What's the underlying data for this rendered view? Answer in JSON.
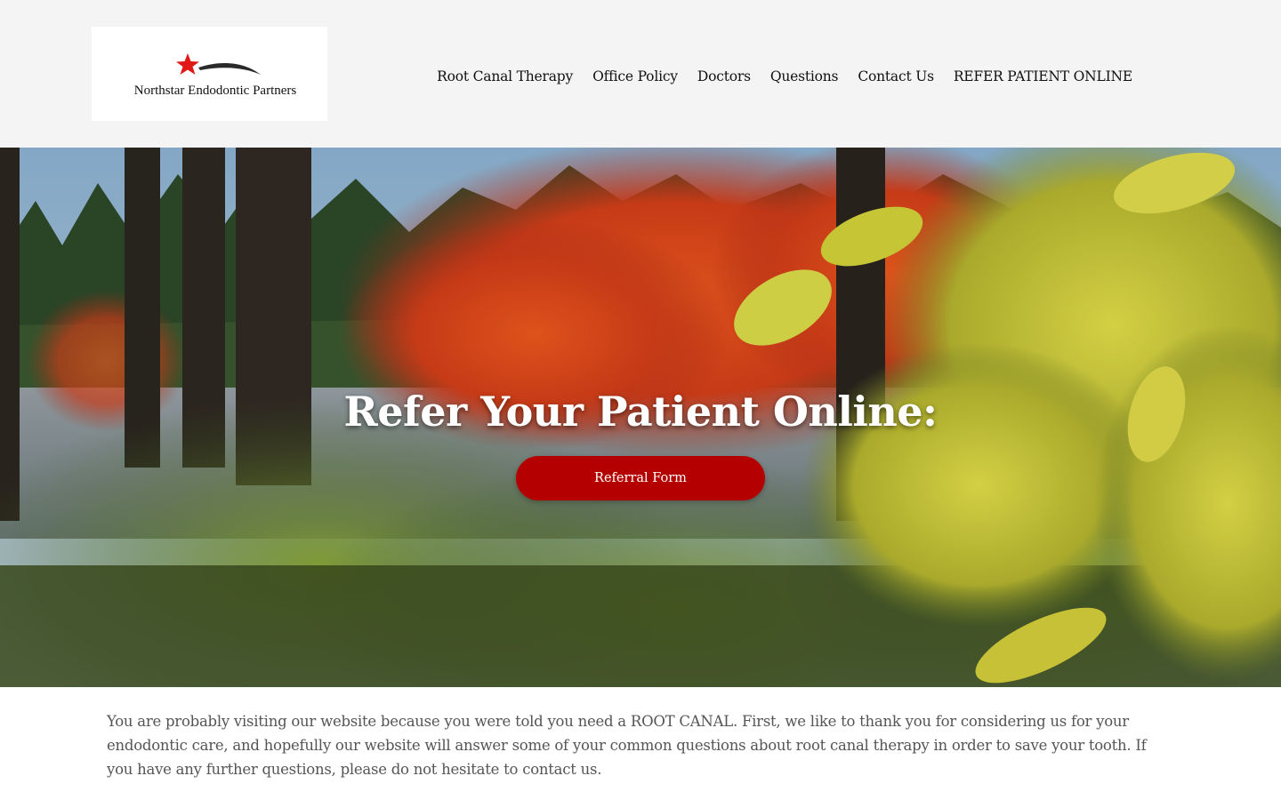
{
  "header": {
    "logo_text": "Northstar Endodontic Partners",
    "nav": [
      {
        "label": "Root Canal Therapy"
      },
      {
        "label": "Office Policy"
      },
      {
        "label": "Doctors"
      },
      {
        "label": "Questions"
      },
      {
        "label": "Contact Us"
      },
      {
        "label": "REFER PATIENT ONLINE"
      }
    ]
  },
  "hero": {
    "title": "Refer Your Patient Online:",
    "button_label": "Referral Form",
    "background_image": "autumn forest with red and yellow foliage beside a pond",
    "button_color": "#b40000"
  },
  "intro": {
    "text": "You are probably visiting our website because you were told you need a ROOT CANAL. First, we like to thank you for considering us for your endodontic care, and hopefully our website will answer some of your common questions about root canal therapy in order to save your tooth. If you have any further questions, please do not hesitate to contact us."
  },
  "colors": {
    "header_bg": "#f4f4f4",
    "accent_red": "#b40000",
    "logo_star": "#e01818"
  }
}
